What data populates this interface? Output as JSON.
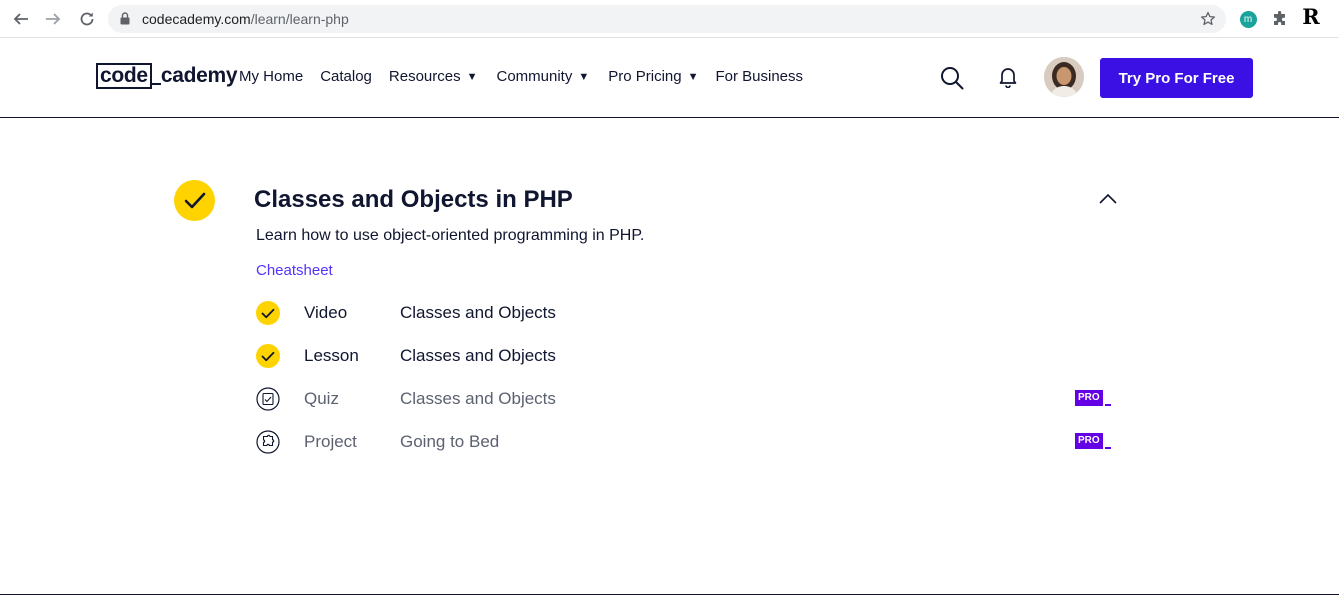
{
  "browser": {
    "url_domain": "codecademy.com",
    "url_path": "/learn/learn-php",
    "ext_m_label": "m",
    "ext_r_label": "R"
  },
  "header": {
    "logo_code": "code",
    "logo_rest": "cademy",
    "nav": [
      {
        "label": "My Home",
        "dropdown": false
      },
      {
        "label": "Catalog",
        "dropdown": false
      },
      {
        "label": "Resources",
        "dropdown": true
      },
      {
        "label": "Community",
        "dropdown": true
      },
      {
        "label": "Pro Pricing",
        "dropdown": true
      },
      {
        "label": "For Business",
        "dropdown": false
      }
    ],
    "caret_glyph": "▼",
    "cta_label": "Try Pro For Free",
    "cta_color": "#3a10e5"
  },
  "module": {
    "title": "Classes and Objects in PHP",
    "description": "Learn how to use object-oriented programming in PHP.",
    "cheatsheet_label": "Cheatsheet",
    "check_color": "#ffd300",
    "items": [
      {
        "type": "Video",
        "name": "Classes and Objects",
        "status": "completed",
        "icon": "check-icon",
        "pro": false
      },
      {
        "type": "Lesson",
        "name": "Classes and Objects",
        "status": "completed",
        "icon": "check-icon",
        "pro": false
      },
      {
        "type": "Quiz",
        "name": "Classes and Objects",
        "status": "locked",
        "icon": "quiz-icon",
        "pro": true
      },
      {
        "type": "Project",
        "name": "Going to Bed",
        "status": "locked",
        "icon": "project-icon",
        "pro": true
      }
    ],
    "pro_label": "PRO",
    "pro_color": "#6400e4"
  }
}
